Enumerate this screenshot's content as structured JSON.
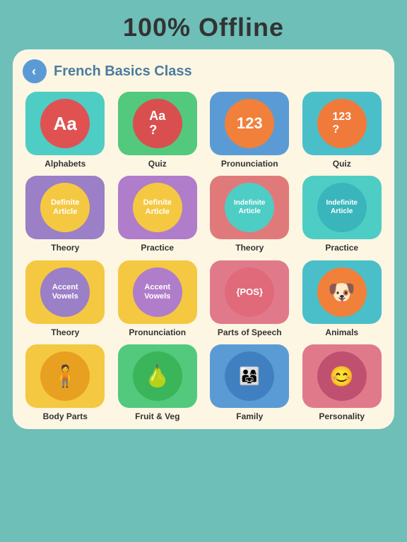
{
  "header": {
    "offline_label": "100% Offline",
    "title": "French Basics Class",
    "back_label": "‹"
  },
  "grid": {
    "rows": [
      [
        {
          "id": "alphabets",
          "bg": "#4ecdc4",
          "circle_bg": "#e05252",
          "text": "Aa",
          "text_size": "big",
          "label": "Alphabets"
        },
        {
          "id": "quiz1",
          "bg": "#52c97c",
          "circle_bg": "#d94f4f",
          "text": "Aa\n?",
          "text_size": "medium",
          "label": "Quiz"
        },
        {
          "id": "pronunciation",
          "bg": "#5b9bd5",
          "circle_bg": "#f0803a",
          "text": "123",
          "text_size": "big",
          "label": "Pronunciation"
        },
        {
          "id": "quiz2",
          "bg": "#4bbfc9",
          "circle_bg": "#f07a3a",
          "text": "123\n?",
          "text_size": "medium",
          "label": "Quiz"
        }
      ],
      [
        {
          "id": "def-article-theory",
          "bg": "#9b7fc7",
          "circle_bg": "#f5c842",
          "text": "Definite\nArticle",
          "text_size": "small",
          "label": "Theory"
        },
        {
          "id": "def-article-practice",
          "bg": "#b07dca",
          "circle_bg": "#f5c842",
          "text": "Definite\nArticle",
          "text_size": "small",
          "label": "Practice"
        },
        {
          "id": "indef-article-theory",
          "bg": "#e07a7a",
          "circle_bg": "#4ecdc4",
          "text": "Indefinite\nArticle",
          "text_size": "small",
          "label": "Theory"
        },
        {
          "id": "indef-article-practice",
          "bg": "#4ecdc4",
          "circle_bg": "#4ecdc4",
          "text": "Indefinite\nArticle",
          "text_size": "small",
          "label": "Practice"
        }
      ],
      [
        {
          "id": "accent-vowels-theory",
          "bg": "#f5c842",
          "circle_bg": "#9b7fc7",
          "text": "Accent\nVowels",
          "text_size": "small",
          "label": "Theory"
        },
        {
          "id": "accent-vowels-pronun",
          "bg": "#f5c842",
          "circle_bg": "#b07dca",
          "text": "Accent\nVowels",
          "text_size": "small",
          "label": "Pronunciation"
        },
        {
          "id": "parts-of-speech",
          "bg": "#e07a8a",
          "circle_bg": "#e06a7a",
          "text": "POS",
          "text_size": "medium",
          "label": "Parts of Speech"
        },
        {
          "id": "animals",
          "bg": "#4bbfc9",
          "circle_bg": "#f0803a",
          "text": "🐶",
          "text_size": "big",
          "label": "Animals"
        }
      ],
      [
        {
          "id": "body-parts",
          "bg": "#f5c842",
          "circle_bg": "#f5c842",
          "text": "🧍",
          "text_size": "big",
          "label": "Body Parts"
        },
        {
          "id": "fruit-veg",
          "bg": "#52c97c",
          "circle_bg": "#52c97c",
          "text": "🍐",
          "text_size": "big",
          "label": "Fruit & Veg"
        },
        {
          "id": "family",
          "bg": "#5b9bd5",
          "circle_bg": "#5b9bd5",
          "text": "👨‍👩‍👧",
          "text_size": "big",
          "label": "Family"
        },
        {
          "id": "personality",
          "bg": "#e07a8a",
          "circle_bg": "#e07a8a",
          "text": "😊",
          "text_size": "big",
          "label": "Personality"
        }
      ]
    ]
  }
}
